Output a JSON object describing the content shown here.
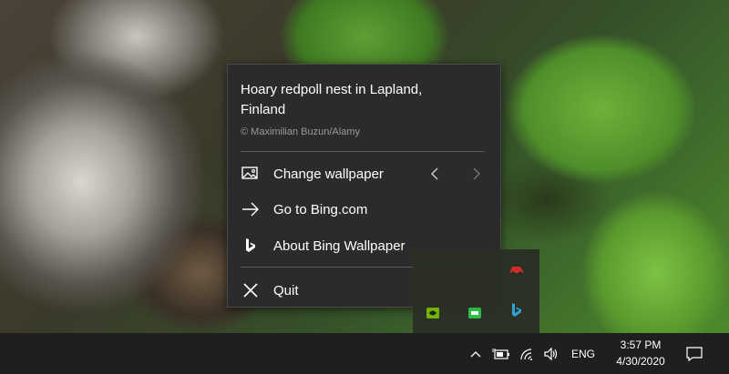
{
  "menu": {
    "title": "Hoary redpoll nest in Lapland, Finland",
    "credit": "© Maximilian Buzun/Alamy",
    "items": [
      {
        "label": "Change wallpaper",
        "icon": "image-icon"
      },
      {
        "label": "Go to Bing.com",
        "icon": "arrow-right-icon"
      },
      {
        "label": "About Bing Wallpaper",
        "icon": "bing-logo-icon"
      },
      {
        "label": "Quit",
        "icon": "close-icon"
      }
    ],
    "prev_icon": "chevron-left-icon",
    "next_icon": "chevron-right-icon"
  },
  "tray_overflow": {
    "icons": [
      "car-app-icon",
      "bing-wallpaper-icon",
      "nvidia-icon",
      "chat-app-icon"
    ]
  },
  "taskbar": {
    "language": "ENG",
    "time": "3:57 PM",
    "date": "4/30/2020",
    "icons": [
      "show-hidden-icons-chevron-icon",
      "battery-icon",
      "wifi-icon",
      "volume-icon",
      "notification-icon"
    ]
  },
  "colors": {
    "menu_background": "#2b2b2b",
    "taskbar_background": "#1f1f1f",
    "bing_accent": "#2ea8e0"
  }
}
